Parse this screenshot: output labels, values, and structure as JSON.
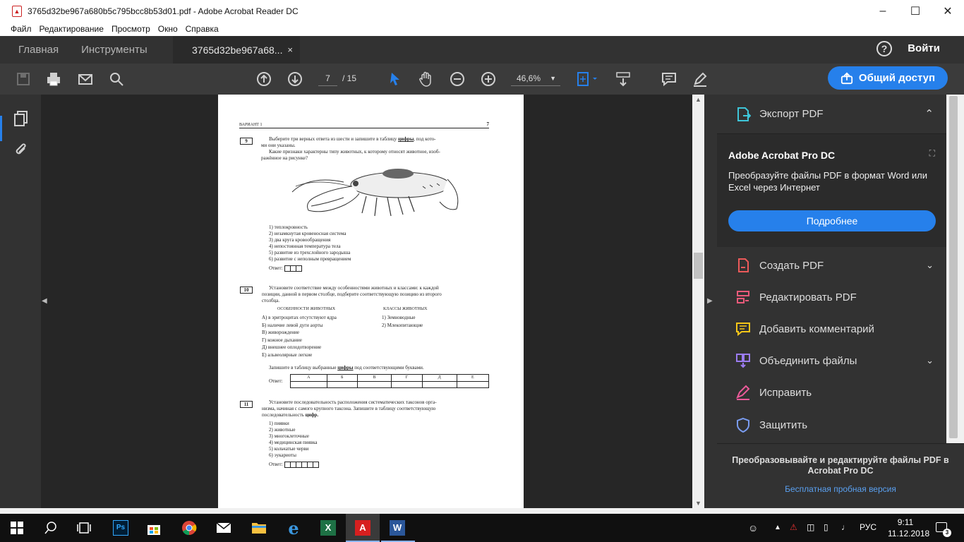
{
  "window": {
    "title": "3765d32be967a680b5c795bcc8b53d01.pdf - Adobe Acrobat Reader DC",
    "controls": [
      "minimize-icon",
      "maximize-icon",
      "close-icon"
    ]
  },
  "menu": [
    "Файл",
    "Редактирование",
    "Просмотр",
    "Окно",
    "Справка"
  ],
  "tabs": {
    "home": "Главная",
    "tools": "Инструменты",
    "doc": "3765d32be967a68...",
    "close": "×"
  },
  "header": {
    "help": "?",
    "login": "Войти"
  },
  "toolbar": {
    "page_current": "7",
    "page_total": "/ 15",
    "zoom": "46,6%",
    "share": "Общий доступ"
  },
  "document": {
    "variant": "ВАРИАНТ 1",
    "page_no": "7",
    "q9": {
      "num": "9",
      "text1": "Выберите три верных ответа из шести и запишите в таблицу",
      "bold1": "цифры",
      "text1b": ", под кото-",
      "text1c": "ми они указаны.",
      "text2": "Какие признаки характерны типу животных, к которому относят животное, изоб-",
      "text2b": "ражённое на рисунке?",
      "options": [
        "1) теплокровность",
        "2) незамкнутая кровеносная система",
        "3) два круга кровообращения",
        "4) непостоянная температура тела",
        "5) развитие из трехслойного зародыша",
        "6) развитие с неполным превращением"
      ],
      "answer_label": "Ответ:"
    },
    "q10": {
      "num": "10",
      "text": "Установите соответствие между особенностями животных и классами: к каждой",
      "textb": "позиции, данной в первом столбце, подберите соответствующую позицию из второго",
      "textc": "столбца.",
      "col1_head": "ОСОБЕННОСТИ ЖИВОТНЫХ",
      "col2_head": "КЛАССЫ ЖИВОТНЫХ",
      "col1": [
        "А) в эритроцитах отсутствуют ядра",
        "Б) наличие левой дуги аорты",
        "В) живорождение",
        "Г) кожное дыхание",
        "Д) внешнее оплодотворение",
        "Е) альвеолярные легкие"
      ],
      "col2": [
        "1) Земноводные",
        "2) Млекопитающие"
      ],
      "instr": "Запишите в таблицу выбранные",
      "instr_bold": "цифры",
      "instr_end": "под соответствующими буквами.",
      "answer_label": "Ответ:",
      "letters": [
        "А",
        "Б",
        "В",
        "Г",
        "Д",
        "Е"
      ]
    },
    "q11": {
      "num": "11",
      "text": "Установите последовательность расположения систематических таксонов орга-",
      "textb": "низма, начиная с самого крупного таксона. Запишите в таблицу соответствующую",
      "textc": "последовательность",
      "textc_bold": "цифр.",
      "options": [
        "1) пиявки",
        "2) животные",
        "3) многоклеточные",
        "4) медицинская пиявка",
        "5) кольчатые черви",
        "6) эукариоты"
      ],
      "answer_label": "Ответ:"
    }
  },
  "right_panel": {
    "export": "Экспорт PDF",
    "promo_title": "Adobe Acrobat Pro DC",
    "promo_text": "Преобразуйте файлы PDF в формат Word или Excel через Интернет",
    "promo_button": "Подробнее",
    "tools": [
      "Создать PDF",
      "Редактировать PDF",
      "Добавить комментарий",
      "Объединить файлы",
      "Исправить",
      "Защитить"
    ],
    "bottom_text": "Преобразовывайте и редактируйте файлы PDF в Acrobat Pro DC",
    "bottom_link": "Бесплатная пробная версия"
  },
  "colors": {
    "accent": "#2680eb",
    "dark": "#323232",
    "toolbar": "#3b3b3b",
    "doc_bg": "#262626"
  },
  "taskbar": {
    "lang": "РУС",
    "time": "9:11",
    "date": "11.12.2018",
    "notifications": "3"
  }
}
